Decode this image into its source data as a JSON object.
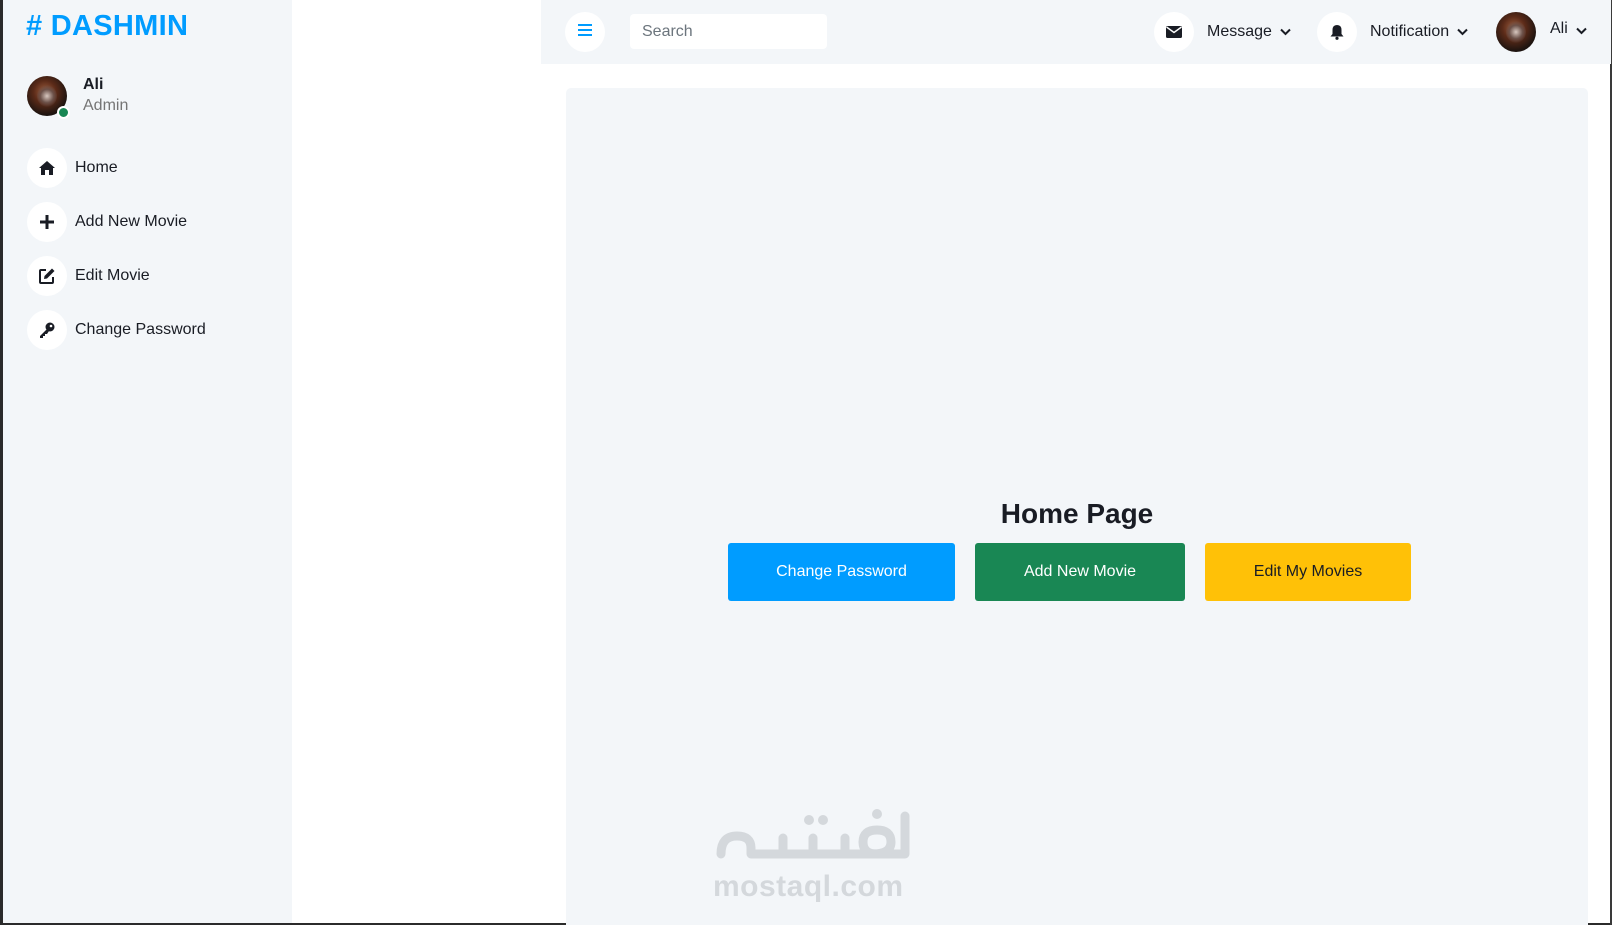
{
  "brand": {
    "symbol": "#",
    "name": "DASHMIN",
    "color": "#009cff"
  },
  "profile": {
    "name": "Ali",
    "role": "Admin",
    "status_color": "#198754"
  },
  "sidebar": {
    "items": [
      {
        "label": "Home",
        "icon": "home-icon"
      },
      {
        "label": "Add New Movie",
        "icon": "plus-icon"
      },
      {
        "label": "Edit Movie",
        "icon": "edit-icon"
      },
      {
        "label": "Change Password",
        "icon": "key-icon"
      }
    ]
  },
  "topbar": {
    "search_placeholder": "Search",
    "message_label": "Message",
    "notification_label": "Notification",
    "user_label": "Ali"
  },
  "main": {
    "title": "Home Page",
    "buttons": {
      "change_password": "Change Password",
      "add_new_movie": "Add New Movie",
      "edit_my_movies": "Edit My Movies"
    }
  },
  "watermark": {
    "arabic": "مستقل",
    "latin": "mostaql.com"
  },
  "colors": {
    "primary": "#009cff",
    "success": "#198754",
    "warning": "#ffc107",
    "light_bg": "#f3f6f9",
    "text_dark": "#191c24"
  }
}
